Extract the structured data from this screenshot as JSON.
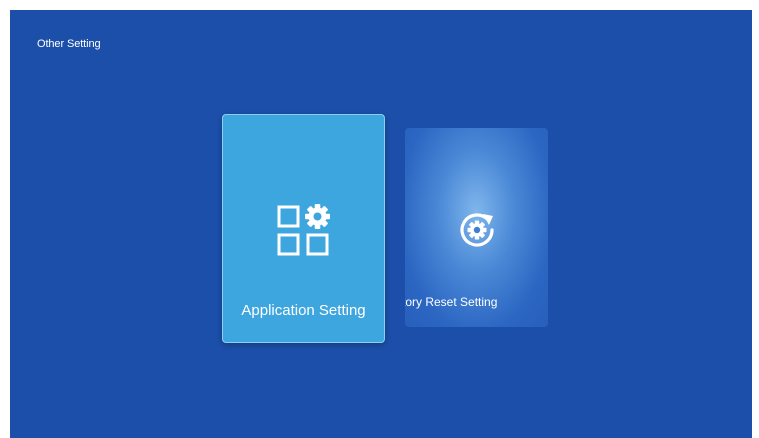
{
  "header": {
    "title": "Other Setting"
  },
  "tiles": [
    {
      "label": "Application Setting",
      "icon": "app-settings-icon",
      "state": "focused"
    },
    {
      "label": "Factory Reset Setting",
      "visible_label": "tory Reset Setting",
      "icon": "factory-reset-icon",
      "state": "unfocused"
    }
  ],
  "colors": {
    "background": "#1c4fa9",
    "focused_tile": "#3ea6df",
    "unfocused_tile": "#2b66c2",
    "text": "#ffffff"
  }
}
